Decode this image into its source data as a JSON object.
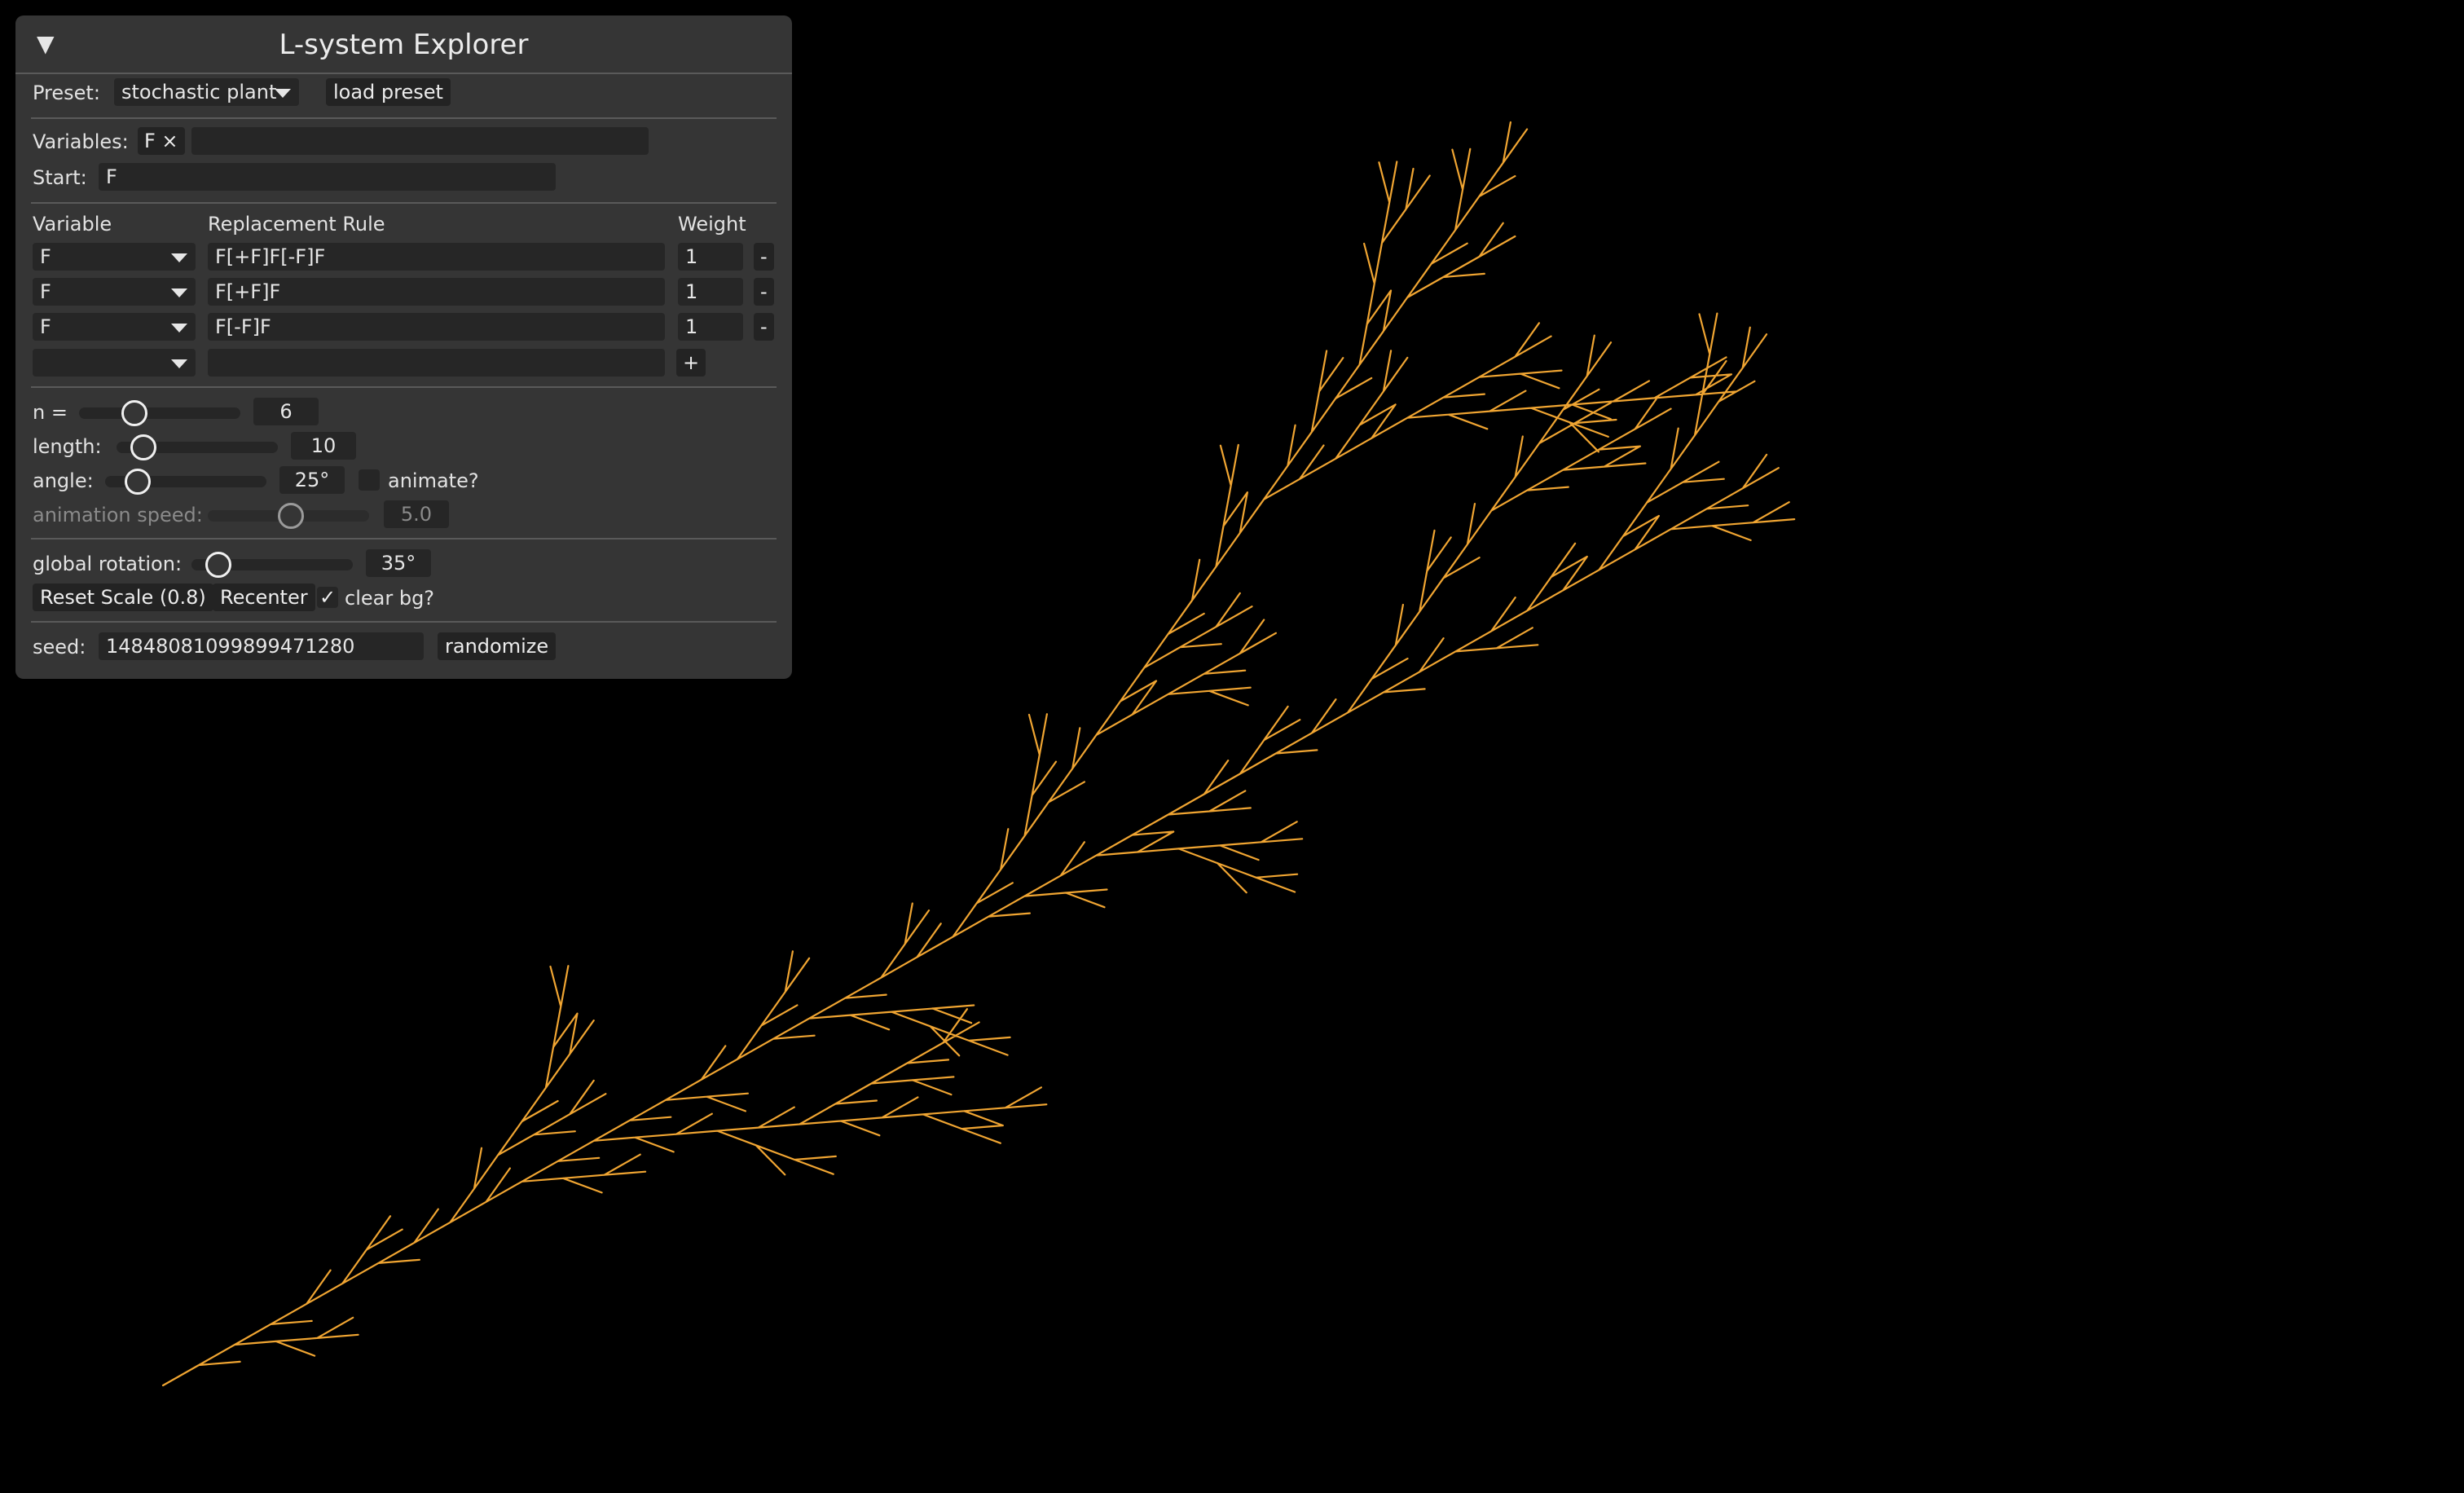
{
  "panel": {
    "collapse_glyph": "▼",
    "title": "L-system Explorer"
  },
  "preset": {
    "label": "Preset:",
    "selected": "stochastic plant",
    "load_button": "load preset"
  },
  "variables": {
    "label": "Variables:",
    "chips": [
      "F ×"
    ],
    "input_value": ""
  },
  "start": {
    "label": "Start:",
    "value": "F"
  },
  "rules": {
    "col_variable": "Variable",
    "col_rule": "Replacement Rule",
    "col_weight": "Weight",
    "rows": [
      {
        "variable": "F",
        "rule": "F[+F]F[-F]F",
        "weight": "1",
        "remove": "-"
      },
      {
        "variable": "F",
        "rule": "F[+F]F",
        "weight": "1",
        "remove": "-"
      },
      {
        "variable": "F",
        "rule": "F[-F]F",
        "weight": "1",
        "remove": "-"
      }
    ],
    "new_row": {
      "variable": "",
      "rule": "",
      "add": "+"
    }
  },
  "params": {
    "n": {
      "label": "n =",
      "value": "6",
      "fraction": 0.3
    },
    "length": {
      "label": "length:",
      "value": "10",
      "fraction": 0.1
    },
    "angle": {
      "label": "angle:",
      "value": "25°",
      "fraction": 0.14
    },
    "animate_label": "animate?",
    "animate_checked": false,
    "animation_speed": {
      "label": "animation speed:",
      "value": "5.0",
      "fraction": 0.5
    }
  },
  "view": {
    "rotation": {
      "label": "global rotation:",
      "value": "35°",
      "fraction": 0.1
    },
    "reset_scale": "Reset Scale (0.8)",
    "recenter": "Recenter",
    "clear_bg_label": "clear bg?",
    "clear_bg_checked": "✓"
  },
  "seed": {
    "label": "seed:",
    "value": "14848081099899471280",
    "randomize": "randomize"
  },
  "colors": {
    "plant": "#f0a532",
    "background": "#000000",
    "panel": "#353535"
  }
}
